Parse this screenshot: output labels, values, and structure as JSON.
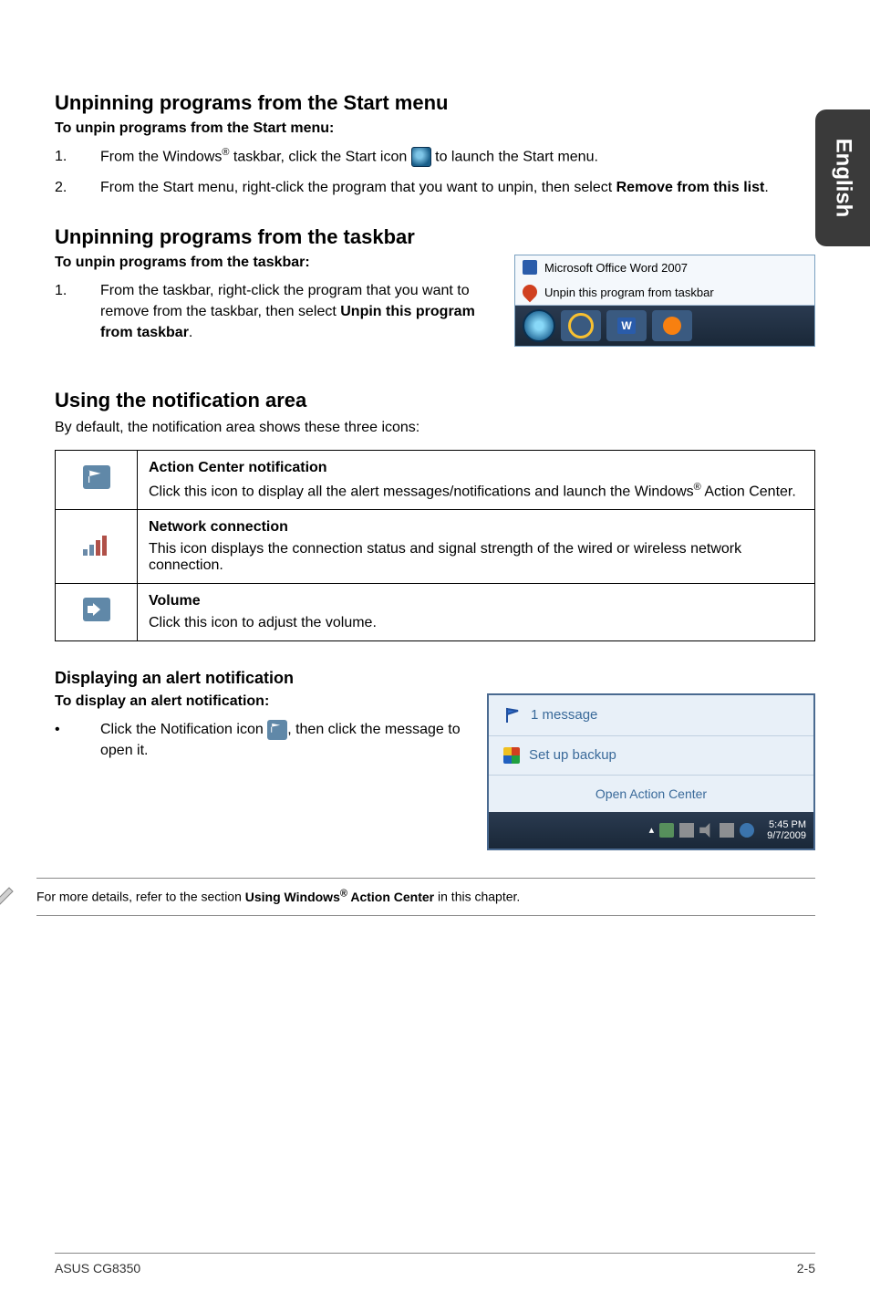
{
  "sideTab": "English",
  "sec1": {
    "heading": "Unpinning programs from the Start menu",
    "subheading": "To unpin programs from the Start menu:",
    "item1_pre": "From the Windows",
    "item1_sup": "®",
    "item1_mid": " taskbar, click the Start icon ",
    "item1_post": " to launch the Start menu.",
    "item2_a": "From the Start menu, right-click the program that you want to unpin, then select ",
    "item2_bold": "Remove from this list",
    "item2_b": "."
  },
  "sec2": {
    "heading": "Unpinning programs from the taskbar",
    "subheading": "To unpin programs from the taskbar:",
    "item1_a": "From the taskbar, right-click the program that you want to remove from the taskbar, then select ",
    "item1_bold": "Unpin this program from taskbar",
    "item1_b": "."
  },
  "taskbar_shot": {
    "menu1": "Microsoft Office Word 2007",
    "menu2": "Unpin this program from taskbar"
  },
  "sec3": {
    "heading": "Using the notification area",
    "desc": "By default, the notification area shows these three icons:"
  },
  "table": {
    "r1_title": "Action Center notification",
    "r1_body_a": "Click this icon to display all the alert messages/notifications and launch the Windows",
    "r1_sup": "®",
    "r1_body_b": " Action Center.",
    "r2_title": "Network connection",
    "r2_body": "This icon displays the connection status and signal strength of the wired or wireless network connection.",
    "r3_title": "Volume",
    "r3_body": "Click this icon to adjust the volume."
  },
  "sec4": {
    "heading": "Displaying an alert notification",
    "subheading": "To display an alert notification:",
    "bullet_a": "Click the Notification icon ",
    "bullet_b": ", then click the message to open it."
  },
  "alert_shot": {
    "row1": "1 message",
    "row2": "Set up backup",
    "row3": "Open Action Center",
    "time": "5:45 PM",
    "date": "9/7/2009"
  },
  "note_a": "For more details, refer to the section ",
  "note_bold": "Using Windows",
  "note_sup": "®",
  "note_bold2": " Action Center",
  "note_b": " in this chapter.",
  "footer_left": "ASUS CG8350",
  "footer_right": "2-5"
}
